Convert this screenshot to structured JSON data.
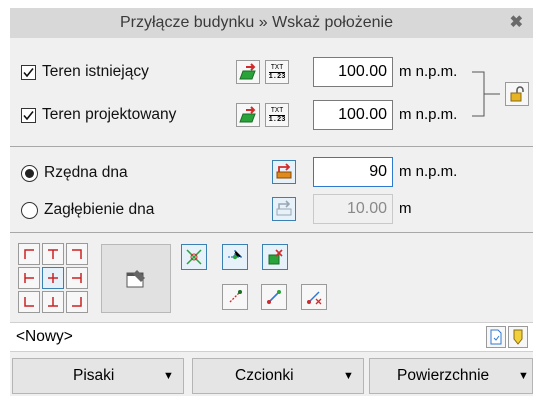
{
  "window": {
    "title": "Przyłącze budynku » Wskaż położenie",
    "close_glyph": "✖"
  },
  "terrain": {
    "existing": {
      "label": "Teren istniejący",
      "checked": true,
      "value": "100.00",
      "unit": "m n.p.m."
    },
    "designed": {
      "label": "Teren projektowany",
      "checked": true,
      "value": "100.00",
      "unit": "m n.p.m."
    },
    "txt_icon": {
      "top": "TXT",
      "bottom": "1.23"
    }
  },
  "bottom_mode": {
    "ordinate": {
      "label": "Rzędna dna",
      "selected": true,
      "value": "90",
      "unit": "m n.p.m."
    },
    "depth": {
      "label": "Zagłębienie dna",
      "selected": false,
      "value": "10.00",
      "unit": "m"
    }
  },
  "name_row": {
    "value": "<Nowy>"
  },
  "dropdowns": [
    {
      "label": "Pisaki"
    },
    {
      "label": "Czcionki"
    },
    {
      "label": "Powierzchnie"
    }
  ],
  "colors": {
    "accent_blue": "#2f7ad0",
    "icon_green": "#2aa33a",
    "icon_red": "#d12a2a",
    "icon_orange": "#e08a1e"
  }
}
